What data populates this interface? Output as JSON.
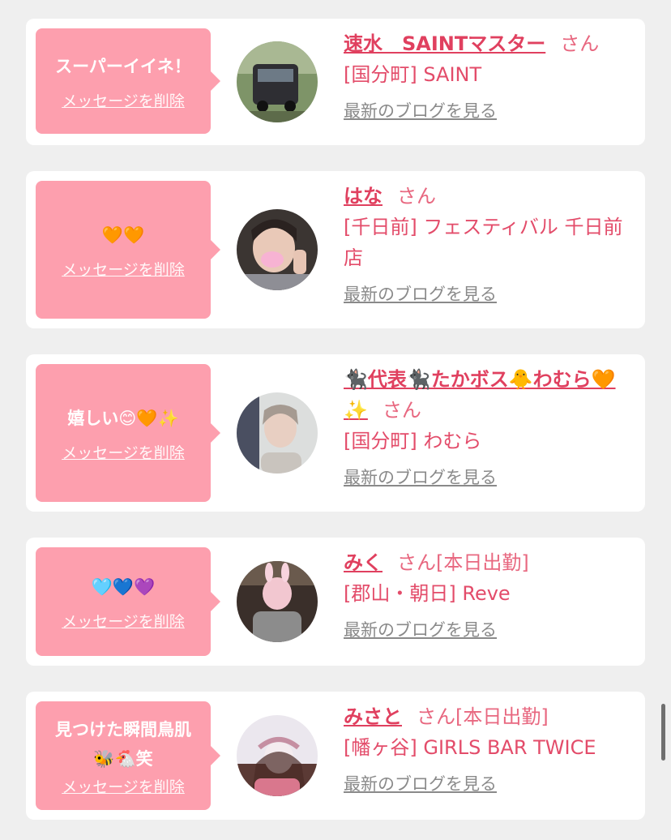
{
  "delete_label": "メッセージを削除",
  "blog_label": "最新のブログを見る",
  "san_label": "さん",
  "cards": [
    {
      "message": "スーパーイイネ！",
      "name": "速水　SAINTマスター",
      "suffix": "さん",
      "shop": "[国分町] SAINT",
      "avatar_icon": "van-photo-icon"
    },
    {
      "message": "🧡🧡",
      "name": "はな",
      "suffix": "さん",
      "shop": "[千日前] フェスティバル 千日前店",
      "avatar_icon": "girl-peace-sign-photo-icon"
    },
    {
      "message": "嬉しい😊🧡✨",
      "name": "🐈‍⬛代表🐈‍⬛たかボス🐥わむら🧡✨",
      "suffix": "さん",
      "shop": "[国分町] わむら",
      "avatar_icon": "woman-portrait-photo-icon"
    },
    {
      "message": "🩵💙💜",
      "name": "みく",
      "suffix": "さん[本日出勤]",
      "shop": "[郡山・朝日] Reve",
      "avatar_icon": "girl-bunny-ears-photo-icon"
    },
    {
      "message": "見つけた瞬間鳥肌\n🐝🐔笑",
      "name": "みさと",
      "suffix": "さん[本日出勤]",
      "shop": "[幡ヶ谷] GIRLS BAR TWICE",
      "avatar_icon": "girl-flower-crown-photo-icon"
    }
  ],
  "colors": {
    "bubble": "#fd9fae",
    "name": "#e0405f",
    "background": "#efefef"
  }
}
